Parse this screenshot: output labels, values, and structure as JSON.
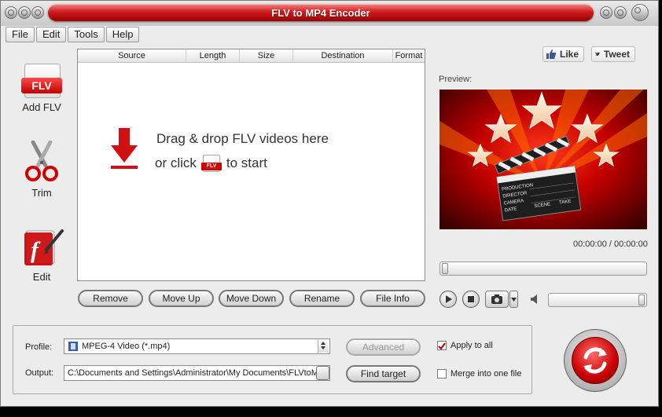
{
  "window": {
    "title": "FLV to MP4 Encoder"
  },
  "menu": [
    "File",
    "Edit",
    "Tools",
    "Help"
  ],
  "tools": {
    "add": "Add FLV",
    "trim": "Trim",
    "edit": "Edit",
    "flv_badge": "FLV"
  },
  "filelist": {
    "columns": [
      "Source",
      "Length",
      "Size",
      "Destination",
      "Format"
    ],
    "drop_line1": "Drag & drop FLV videos here",
    "drop_or": "or click",
    "drop_to_start": "to start"
  },
  "list_buttons": [
    "Remove",
    "Move Up",
    "Move Down",
    "Rename",
    "File Info"
  ],
  "social": {
    "like": "Like",
    "tweet": "Tweet"
  },
  "preview": {
    "label": "Preview:",
    "timecode": "00:00:00 / 00:00:00",
    "clapper_lines": [
      "PRODUCTION",
      "DIRECTOR",
      "CAMERA",
      "DATE",
      "SCENE",
      "TAKE"
    ]
  },
  "settings": {
    "profile_label": "Profile:",
    "profile_value": "MPEG-4 Video (*.mp4)",
    "output_label": "Output:",
    "output_value": "C:\\Documents and Settings\\Administrator\\My Documents\\FLVtoMP",
    "advanced": "Advanced",
    "find_target": "Find target",
    "apply_to_all": "Apply to all",
    "apply_to_all_checked": true,
    "merge": "Merge into one file",
    "merge_checked": false
  },
  "colors": {
    "accent": "#d21c1c",
    "preview_bg": "#8a0000"
  }
}
